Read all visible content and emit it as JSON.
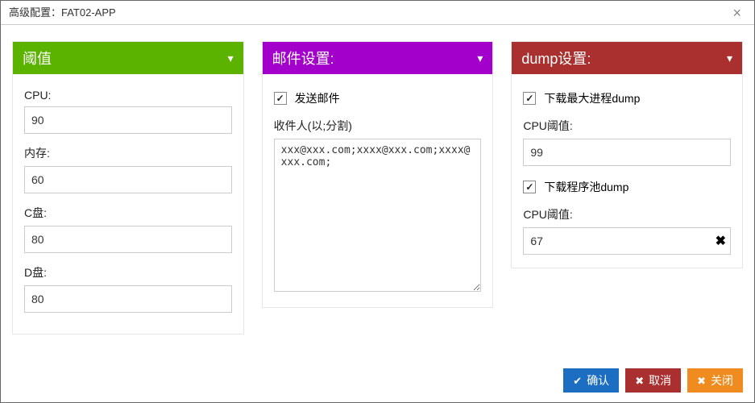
{
  "window": {
    "title": "高级配置：FAT02-APP",
    "close_icon": "×"
  },
  "threshold": {
    "header": "阈值",
    "cpu_label": "CPU:",
    "cpu_value": "90",
    "mem_label": "内存:",
    "mem_value": "60",
    "cdrive_label": "C盘:",
    "cdrive_value": "80",
    "ddrive_label": "D盘:",
    "ddrive_value": "80"
  },
  "mail": {
    "header": "邮件设置:",
    "send_mail_checked": true,
    "send_mail_label": "发送邮件",
    "recipients_label": "收件人(以;分割)",
    "recipients_value": "xxx@xxx.com;xxxx@xxx.com;xxxx@xxx.com;"
  },
  "dump": {
    "header": "dump设置:",
    "max_proc_checked": true,
    "max_proc_label": "下载最大进程dump",
    "cpu_threshold1_label": "CPU阈值:",
    "cpu_threshold1_value": "99",
    "pool_checked": true,
    "pool_label": "下载程序池dump",
    "cpu_threshold2_label": "CPU阈值:",
    "cpu_threshold2_value": "67",
    "clear_icon": "✖"
  },
  "footer": {
    "confirm": "确认",
    "cancel": "取消",
    "close": "关闭"
  },
  "icons": {
    "chevron_down": "▾",
    "check": "✔",
    "cross": "✖"
  }
}
